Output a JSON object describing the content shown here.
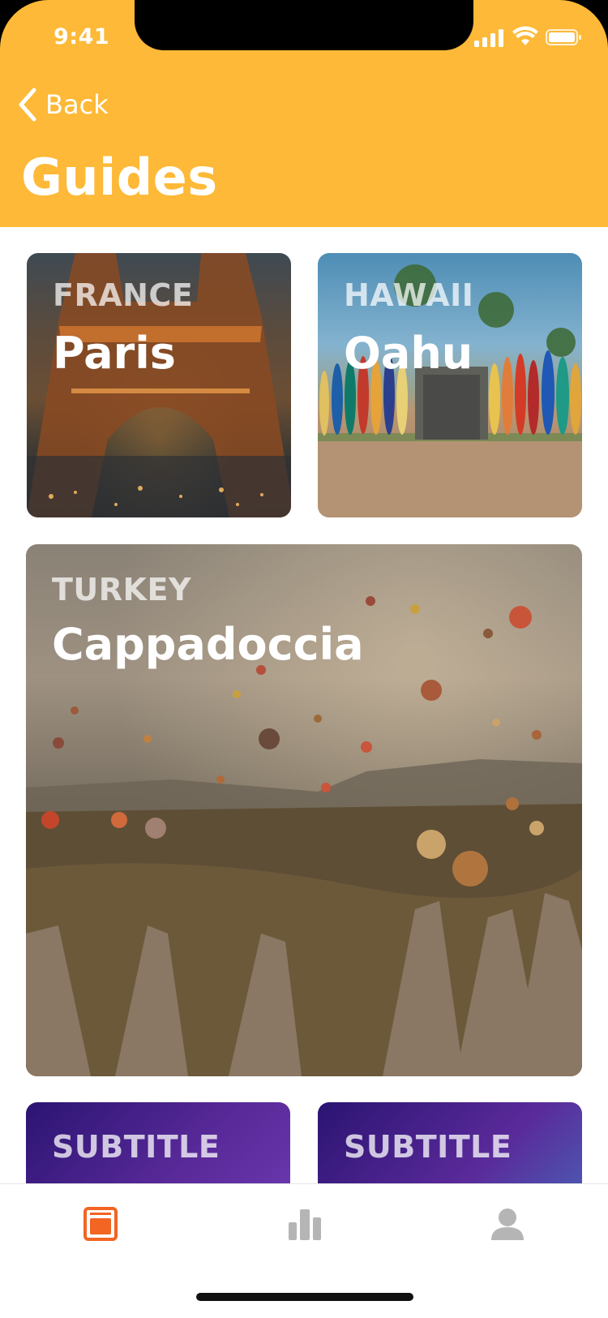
{
  "status_bar": {
    "time": "9:41"
  },
  "header": {
    "back_label": "Back",
    "title": "Guides"
  },
  "guides": [
    {
      "country": "FRANCE",
      "city": "Paris"
    },
    {
      "country": "HAWAII",
      "city": "Oahu"
    },
    {
      "country": "TURKEY",
      "city": "Cappadoccia"
    }
  ],
  "subtitle_cards": [
    {
      "label": "SUBTITLE"
    },
    {
      "label": "SUBTITLE"
    }
  ],
  "tab_bar": {
    "tabs": [
      {
        "icon": "book-icon",
        "active": true
      },
      {
        "icon": "bar-chart-icon",
        "active": false
      },
      {
        "icon": "person-icon",
        "active": false
      }
    ],
    "active_color": "#F26522",
    "inactive_color": "#B5B5B5"
  },
  "colors": {
    "header": "#FDB937"
  }
}
